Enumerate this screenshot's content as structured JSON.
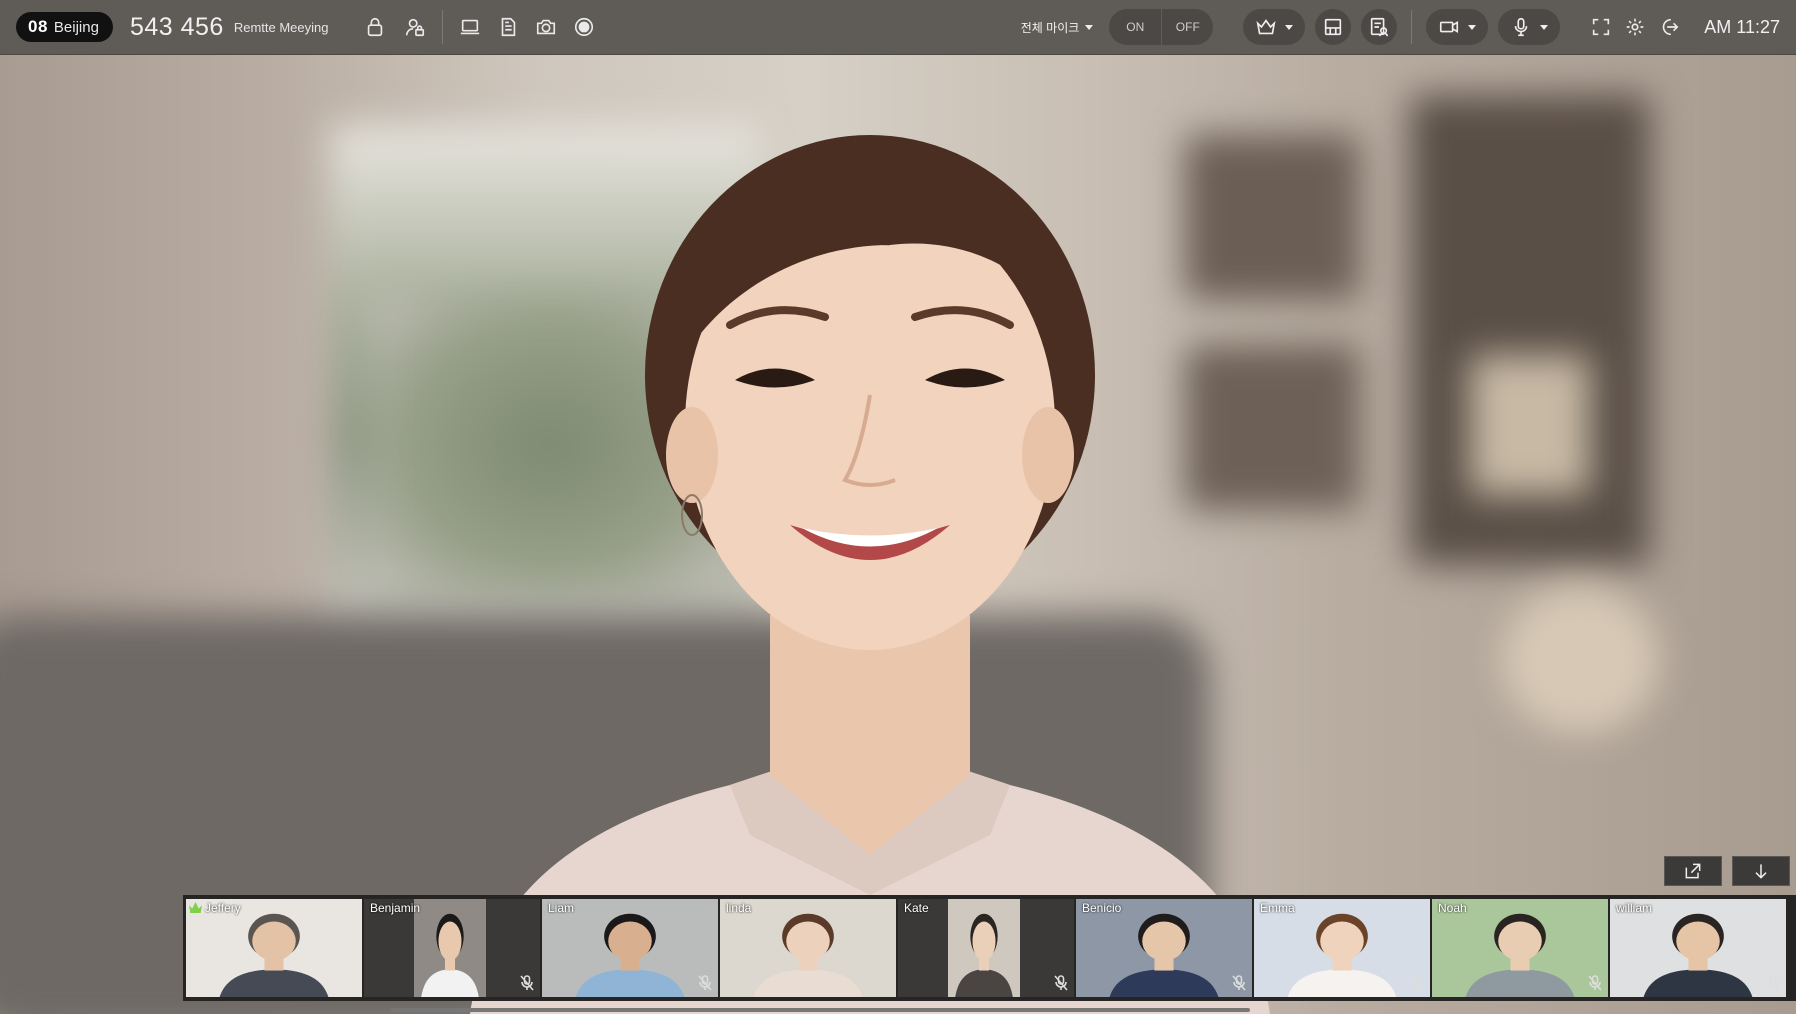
{
  "room": {
    "number": "08",
    "city": "Beijing"
  },
  "meeting": {
    "id": "543 456",
    "name": "Remtte Meeying"
  },
  "mic_all": {
    "label": "전체 마이크"
  },
  "mic_toggle": {
    "on": "ON",
    "off": "OFF"
  },
  "clock": "AM 11:27",
  "participants": [
    {
      "name": "Jeffery",
      "host": true,
      "muted": false,
      "bg": "#e9e6e2",
      "skin": "#e3c2a6",
      "hair": "#5a5551",
      "suit": "#454a55"
    },
    {
      "name": "Benjamin",
      "host": false,
      "muted": true,
      "bg": "#3a3938",
      "skin": "#e8c9ad",
      "hair": "#1c1a19",
      "suit": "#f2f2f2"
    },
    {
      "name": "Liam",
      "host": false,
      "muted": true,
      "bg": "#b9bcbb",
      "skin": "#d9b08f",
      "hair": "#1a1818",
      "suit": "#8fb4d6"
    },
    {
      "name": "linda",
      "host": false,
      "muted": false,
      "bg": "#dcd8cf",
      "skin": "#ecd2bc",
      "hair": "#5a3a28",
      "suit": "#e9ddd3"
    },
    {
      "name": "Kate",
      "host": false,
      "muted": true,
      "bg": "#3a3938",
      "skin": "#ebd0b9",
      "hair": "#2b2523",
      "suit": "#4a4443"
    },
    {
      "name": "Benicio",
      "host": false,
      "muted": true,
      "bg": "#8d97a6",
      "skin": "#e6c6a8",
      "hair": "#1f1c1b",
      "suit": "#2e3a59"
    },
    {
      "name": "Emma",
      "host": false,
      "muted": true,
      "bg": "#d6dde6",
      "skin": "#efd3bd",
      "hair": "#6a4328",
      "suit": "#f5f2ef"
    },
    {
      "name": "Noah",
      "host": false,
      "muted": true,
      "bg": "#a9c79a",
      "skin": "#e9cdb3",
      "hair": "#2a2421",
      "suit": "#8f9aa0"
    },
    {
      "name": "william",
      "host": false,
      "muted": true,
      "bg": "#dfe0e1",
      "skin": "#e6c5a7",
      "hair": "#2a2423",
      "suit": "#2f3643"
    }
  ]
}
